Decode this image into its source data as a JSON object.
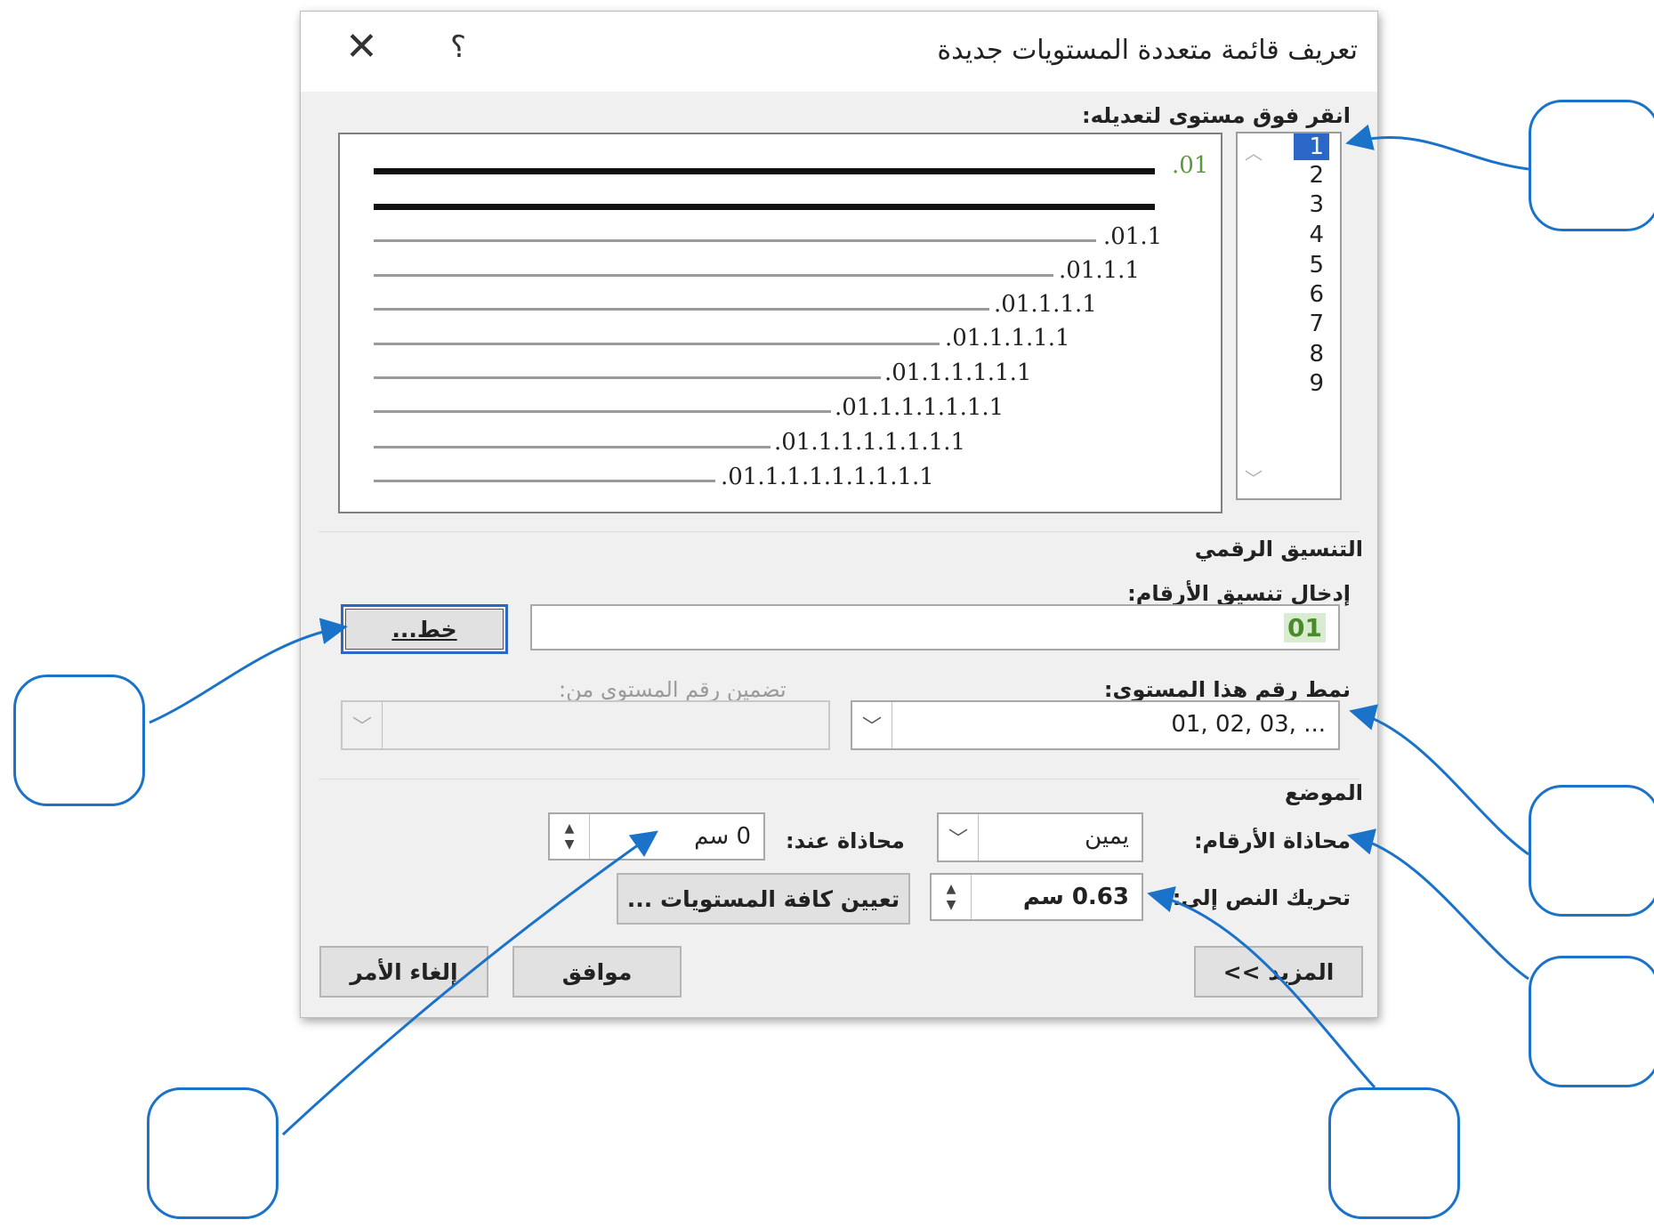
{
  "dialog": {
    "title": "تعريف قائمة متعددة المستويات جديدة",
    "close_symbol": "✕",
    "help_symbol": "؟"
  },
  "level_section": {
    "label": "انقر فوق مستوى لتعديله:",
    "levels": [
      "1",
      "2",
      "3",
      "4",
      "5",
      "6",
      "7",
      "8",
      "9"
    ],
    "selected_level": "1"
  },
  "preview": {
    "labels": [
      ".01",
      "",
      ".01.1",
      ".01.1.1",
      ".01.1.1.1",
      ".01.1.1.1.1",
      ".01.1.1.1.1.1",
      ".01.1.1.1.1.1.1",
      ".01.1.1.1.1.1.1.1",
      ".01.1.1.1.1.1.1.1.1"
    ]
  },
  "number_format": {
    "section_label": "التنسيق الرقمي",
    "enter_format_label": "إدخال تنسيق الأرقام:",
    "format_value": "01",
    "font_button": "خط...",
    "style_label": "نمط رقم هذا المستوى:",
    "style_value": "... ,03 ,02 ,01",
    "include_label": "تضمين رقم المستوى من:",
    "include_value": ""
  },
  "position": {
    "section_label": "الموضع",
    "alignment_label": "محاذاة الأرقام:",
    "alignment_value": "يمين",
    "aligned_at_label": "محاذاة عند:",
    "aligned_at_value": "0 سم",
    "indent_label": "تحريك النص إلى:",
    "indent_value": "0.63 سم",
    "set_all_button": "تعيين كافة المستويات ..."
  },
  "footer": {
    "more_button": "المزيد >>",
    "ok_button": "موافق",
    "cancel_button": "إلغاء الأمر"
  },
  "colors": {
    "accent": "#1a73c8",
    "selection": "#2a67c7",
    "format_green": "#4a8a2a"
  }
}
